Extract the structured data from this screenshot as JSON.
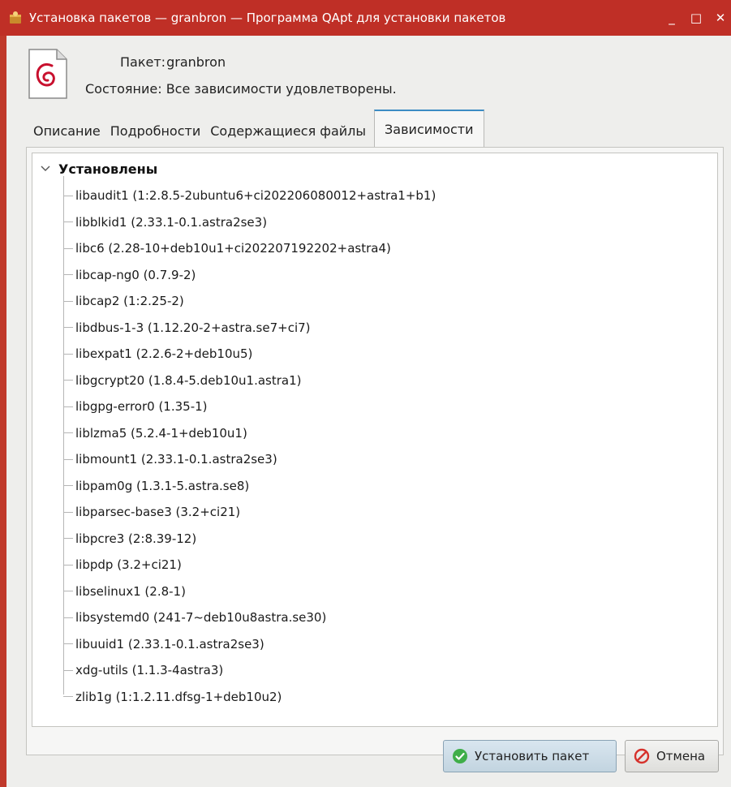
{
  "window": {
    "title": "Установка пакетов — granbron — Программа QApt для установки пакетов",
    "controls": {
      "minimize": "_",
      "maximize": "□",
      "close": "✕"
    }
  },
  "package": {
    "name_label": "Пакет:",
    "name_value": "granbron",
    "state_label": "Состояние:",
    "state_value": "Все зависимости удовлетворены."
  },
  "tabs": [
    {
      "label": "Описание",
      "active": false
    },
    {
      "label": "Подробности",
      "active": false
    },
    {
      "label": "Содержащиеся файлы",
      "active": false
    },
    {
      "label": "Зависимости",
      "active": true
    }
  ],
  "dependencies": {
    "group_label": "Установлены",
    "expanded": true,
    "items": [
      "libaudit1 (1:2.8.5-2ubuntu6+ci202206080012+astra1+b1)",
      "libblkid1 (2.33.1-0.1.astra2se3)",
      "libc6 (2.28-10+deb10u1+ci202207192202+astra4)",
      "libcap-ng0 (0.7.9-2)",
      "libcap2 (1:2.25-2)",
      "libdbus-1-3 (1.12.20-2+astra.se7+ci7)",
      "libexpat1 (2.2.6-2+deb10u5)",
      "libgcrypt20 (1.8.4-5.deb10u1.astra1)",
      "libgpg-error0 (1.35-1)",
      "liblzma5 (5.2.4-1+deb10u1)",
      "libmount1 (2.33.1-0.1.astra2se3)",
      "libpam0g (1.3.1-5.astra.se8)",
      "libparsec-base3 (3.2+ci21)",
      "libpcre3 (2:8.39-12)",
      "libpdp (3.2+ci21)",
      "libselinux1 (2.8-1)",
      "libsystemd0 (241-7~deb10u8astra.se30)",
      "libuuid1 (2.33.1-0.1.astra2se3)",
      "xdg-utils (1.1.3-4astra3)",
      "zlib1g (1:1.2.11.dfsg-1+deb10u2)"
    ]
  },
  "buttons": {
    "install": "Установить пакет",
    "cancel": "Отмена"
  },
  "colors": {
    "titlebar": "#bf2f26",
    "accent": "#3c8cc4",
    "install_icon": "#3fae49",
    "cancel_icon": "#d6322c"
  }
}
